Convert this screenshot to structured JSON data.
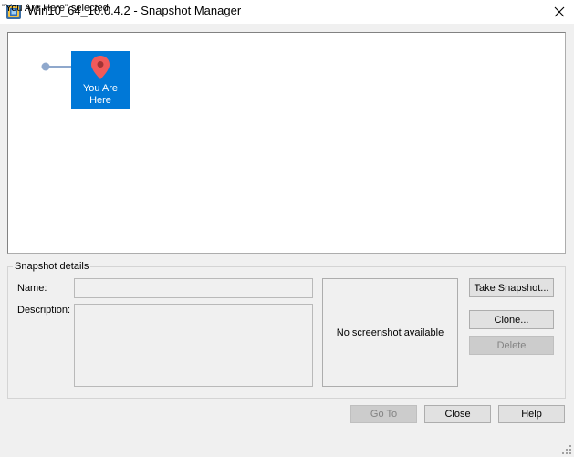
{
  "window": {
    "title": "Win10_64_10.0.4.2 - Snapshot Manager",
    "close_glyph": "✕"
  },
  "tree": {
    "nodes": [
      {
        "label": "You Are\nHere",
        "icon": "map-pin-icon",
        "selected": true
      }
    ],
    "colors": {
      "selection": "#0078d7",
      "pin": "#f05a5a",
      "line": "#8fa8cc"
    }
  },
  "details": {
    "group_title": "Snapshot details",
    "name_label": "Name:",
    "name_value": "",
    "description_label": "Description:",
    "description_value": "",
    "screenshot_text": "No screenshot available"
  },
  "buttons": {
    "take_snapshot": "Take Snapshot...",
    "clone": "Clone...",
    "delete": "Delete",
    "go_to": "Go To",
    "close": "Close",
    "help": "Help"
  },
  "status": {
    "text": "\"You Are Here\" selected"
  }
}
